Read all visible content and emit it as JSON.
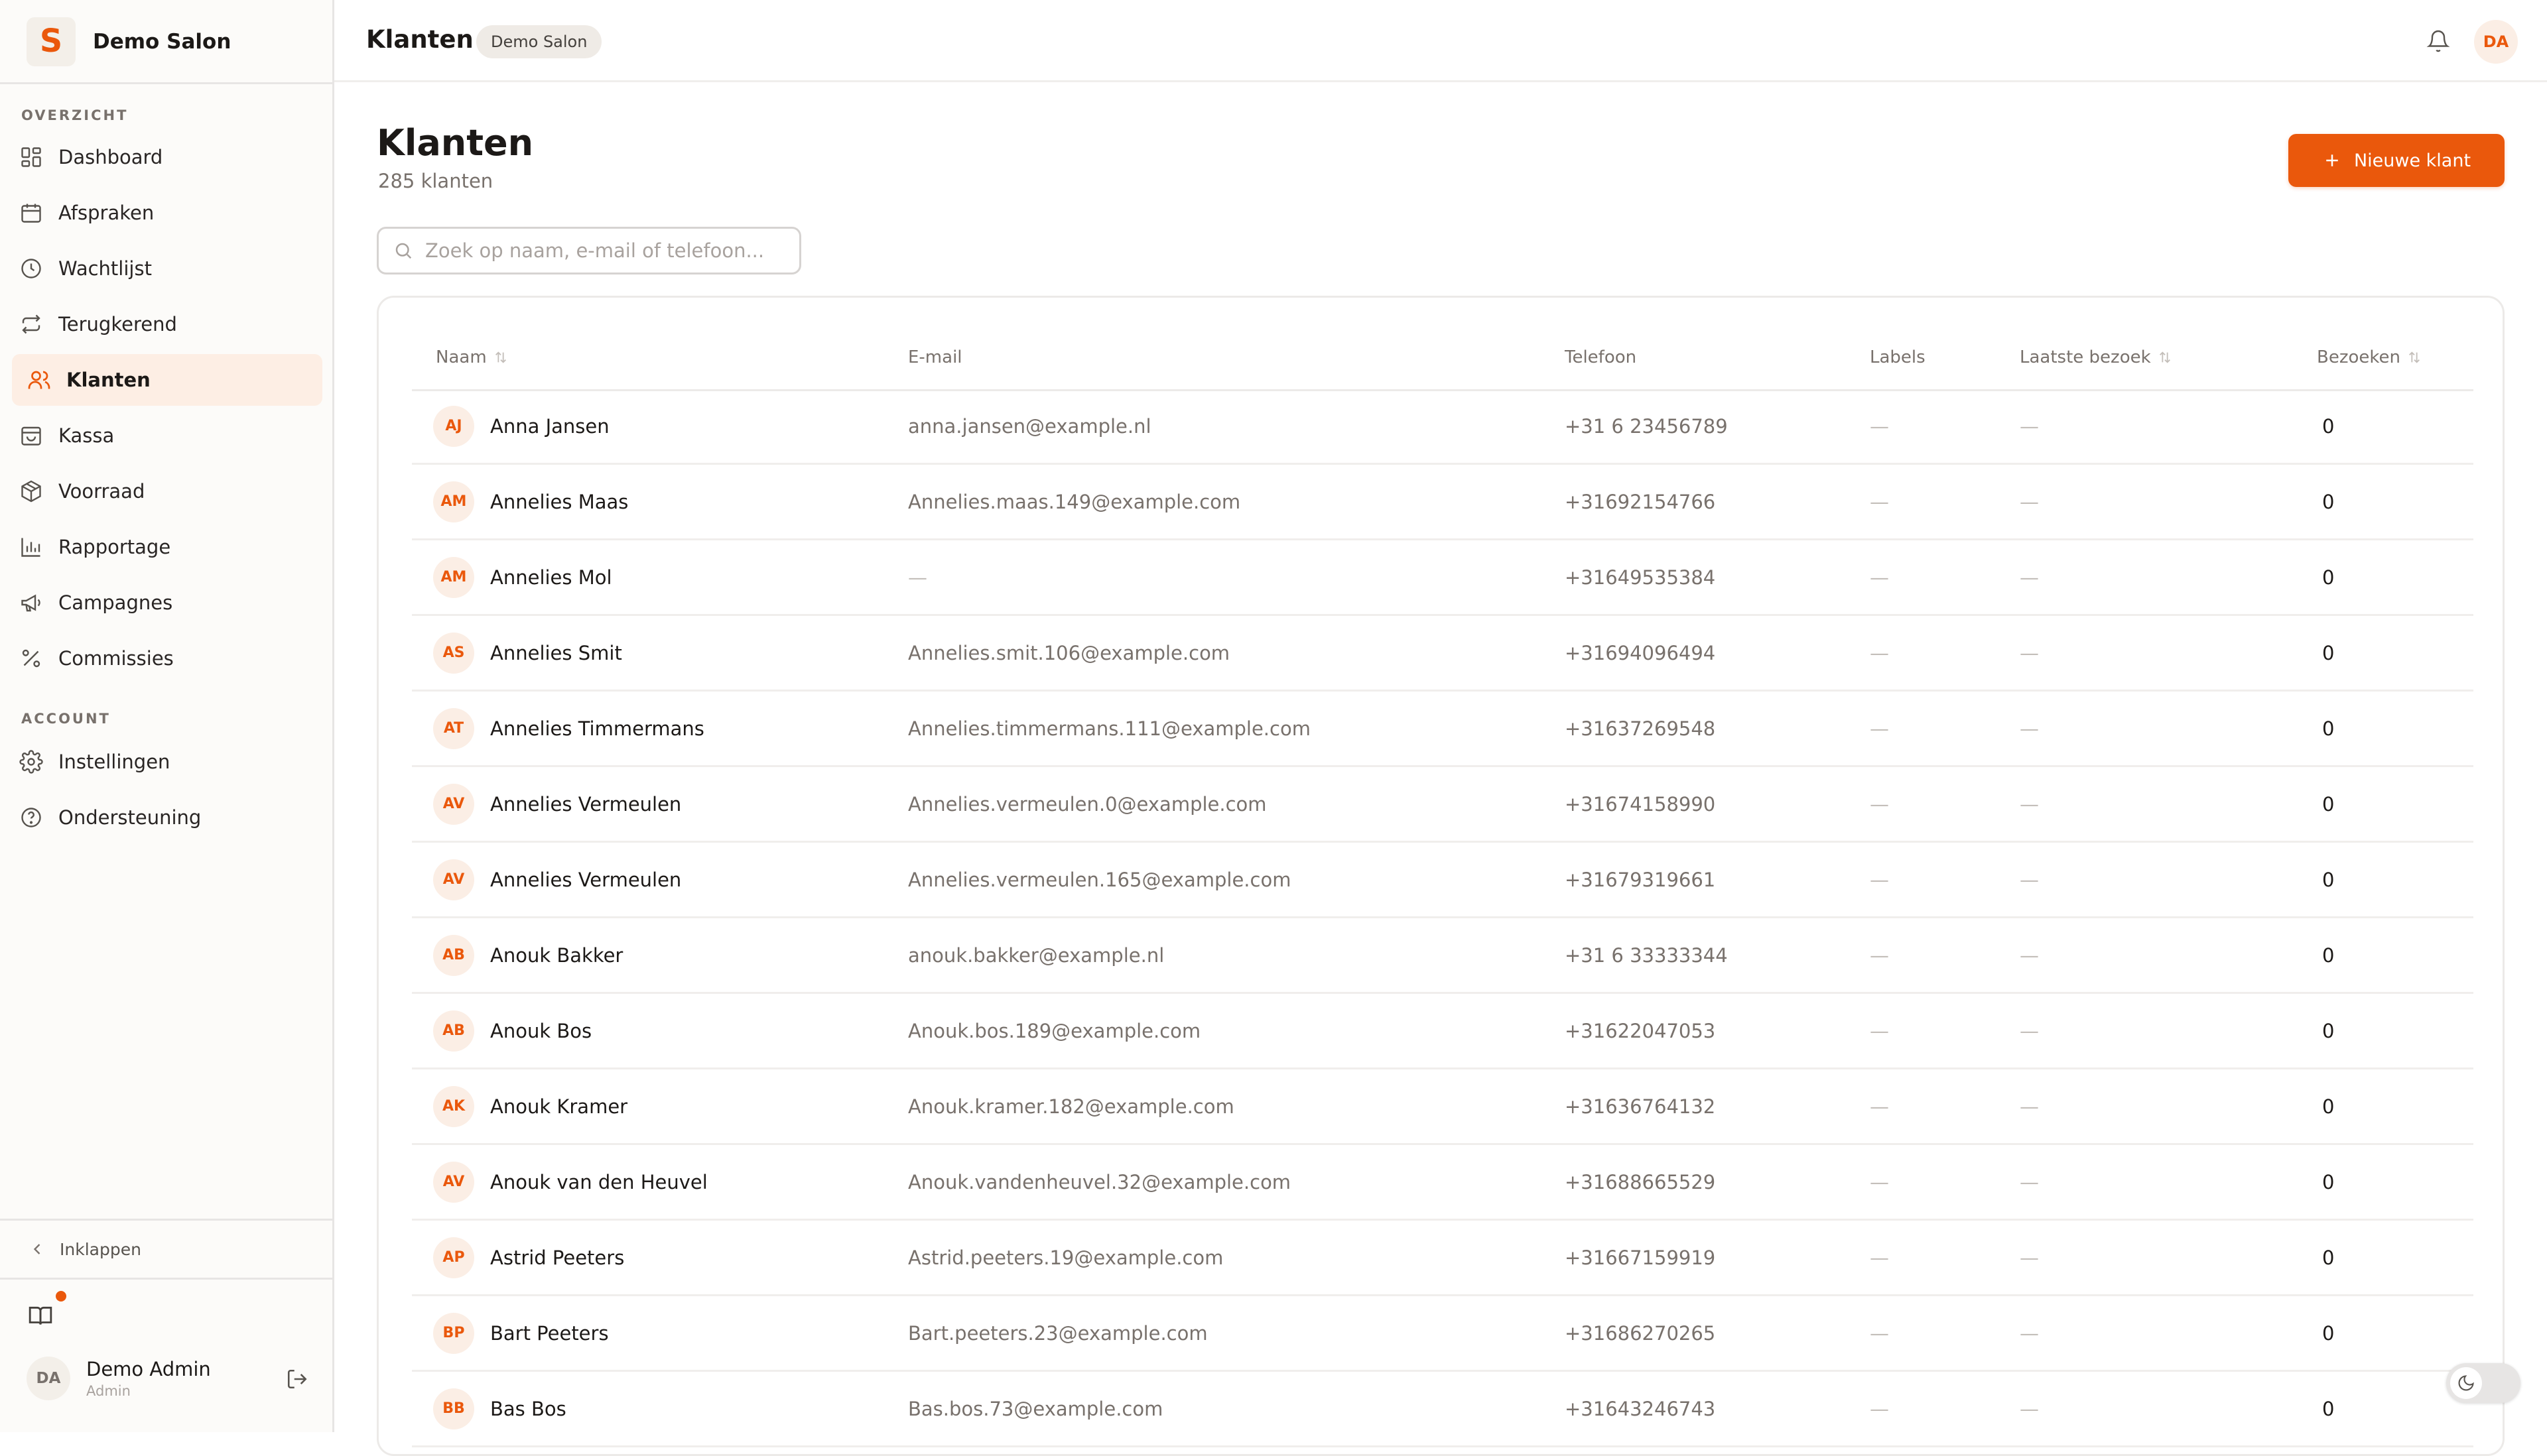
{
  "brand": {
    "name": "Demo Salon",
    "logo_letter": "S"
  },
  "sidebar": {
    "section_overview": "OVERZICHT",
    "section_account": "ACCOUNT",
    "overview_items": [
      {
        "label": "Dashboard",
        "icon": "dashboard-icon"
      },
      {
        "label": "Afspraken",
        "icon": "calendar-icon"
      },
      {
        "label": "Wachtlijst",
        "icon": "clock-icon"
      },
      {
        "label": "Terugkerend",
        "icon": "repeat-icon"
      },
      {
        "label": "Klanten",
        "icon": "users-icon",
        "active": true
      },
      {
        "label": "Kassa",
        "icon": "shopping-bag-icon"
      },
      {
        "label": "Voorraad",
        "icon": "package-icon"
      },
      {
        "label": "Rapportage",
        "icon": "bar-chart-icon"
      },
      {
        "label": "Campagnes",
        "icon": "megaphone-icon"
      },
      {
        "label": "Commissies",
        "icon": "percent-icon"
      }
    ],
    "account_items": [
      {
        "label": "Instellingen",
        "icon": "gear-icon"
      },
      {
        "label": "Ondersteuning",
        "icon": "help-circle-icon"
      }
    ],
    "collapse_label": "Inklappen",
    "user": {
      "initials": "DA",
      "name": "Demo Admin",
      "role": "Admin"
    }
  },
  "topbar": {
    "title": "Klanten",
    "badge": "Demo Salon",
    "avatar_initials": "DA"
  },
  "page": {
    "title": "Klanten",
    "subtitle": "285 klanten",
    "new_button": "Nieuwe klant",
    "search_placeholder": "Zoek op naam, e-mail of telefoon..."
  },
  "table": {
    "columns": {
      "name": "Naam",
      "email": "E-mail",
      "phone": "Telefoon",
      "labels": "Labels",
      "last_visit": "Laatste bezoek",
      "visits": "Bezoeken"
    },
    "rows": [
      {
        "initials": "AJ",
        "name": "Anna Jansen",
        "email": "anna.jansen@example.nl",
        "phone": "+31 6 23456789",
        "labels": "—",
        "last_visit": "—",
        "visits": "0"
      },
      {
        "initials": "AM",
        "name": "Annelies Maas",
        "email": "Annelies.maas.149@example.com",
        "phone": "+31692154766",
        "labels": "—",
        "last_visit": "—",
        "visits": "0"
      },
      {
        "initials": "AM",
        "name": "Annelies Mol",
        "email": "—",
        "phone": "+31649535384",
        "labels": "—",
        "last_visit": "—",
        "visits": "0"
      },
      {
        "initials": "AS",
        "name": "Annelies Smit",
        "email": "Annelies.smit.106@example.com",
        "phone": "+31694096494",
        "labels": "—",
        "last_visit": "—",
        "visits": "0"
      },
      {
        "initials": "AT",
        "name": "Annelies Timmermans",
        "email": "Annelies.timmermans.111@example.com",
        "phone": "+31637269548",
        "labels": "—",
        "last_visit": "—",
        "visits": "0"
      },
      {
        "initials": "AV",
        "name": "Annelies Vermeulen",
        "email": "Annelies.vermeulen.0@example.com",
        "phone": "+31674158990",
        "labels": "—",
        "last_visit": "—",
        "visits": "0"
      },
      {
        "initials": "AV",
        "name": "Annelies Vermeulen",
        "email": "Annelies.vermeulen.165@example.com",
        "phone": "+31679319661",
        "labels": "—",
        "last_visit": "—",
        "visits": "0"
      },
      {
        "initials": "AB",
        "name": "Anouk Bakker",
        "email": "anouk.bakker@example.nl",
        "phone": "+31 6 33333344",
        "labels": "—",
        "last_visit": "—",
        "visits": "0"
      },
      {
        "initials": "AB",
        "name": "Anouk Bos",
        "email": "Anouk.bos.189@example.com",
        "phone": "+31622047053",
        "labels": "—",
        "last_visit": "—",
        "visits": "0"
      },
      {
        "initials": "AK",
        "name": "Anouk Kramer",
        "email": "Anouk.kramer.182@example.com",
        "phone": "+31636764132",
        "labels": "—",
        "last_visit": "—",
        "visits": "0"
      },
      {
        "initials": "AV",
        "name": "Anouk van den Heuvel",
        "email": "Anouk.vandenheuvel.32@example.com",
        "phone": "+31688665529",
        "labels": "—",
        "last_visit": "—",
        "visits": "0"
      },
      {
        "initials": "AP",
        "name": "Astrid Peeters",
        "email": "Astrid.peeters.19@example.com",
        "phone": "+31667159919",
        "labels": "—",
        "last_visit": "—",
        "visits": "0"
      },
      {
        "initials": "BP",
        "name": "Bart Peeters",
        "email": "Bart.peeters.23@example.com",
        "phone": "+31686270265",
        "labels": "—",
        "last_visit": "—",
        "visits": "0"
      },
      {
        "initials": "BB",
        "name": "Bas Bos",
        "email": "Bas.bos.73@example.com",
        "phone": "+31643246743",
        "labels": "—",
        "last_visit": "—",
        "visits": "0"
      }
    ]
  },
  "colors": {
    "accent": "#ea580c",
    "accent_soft": "#fdeee4",
    "text": "#1c1917",
    "muted": "#78716c"
  }
}
